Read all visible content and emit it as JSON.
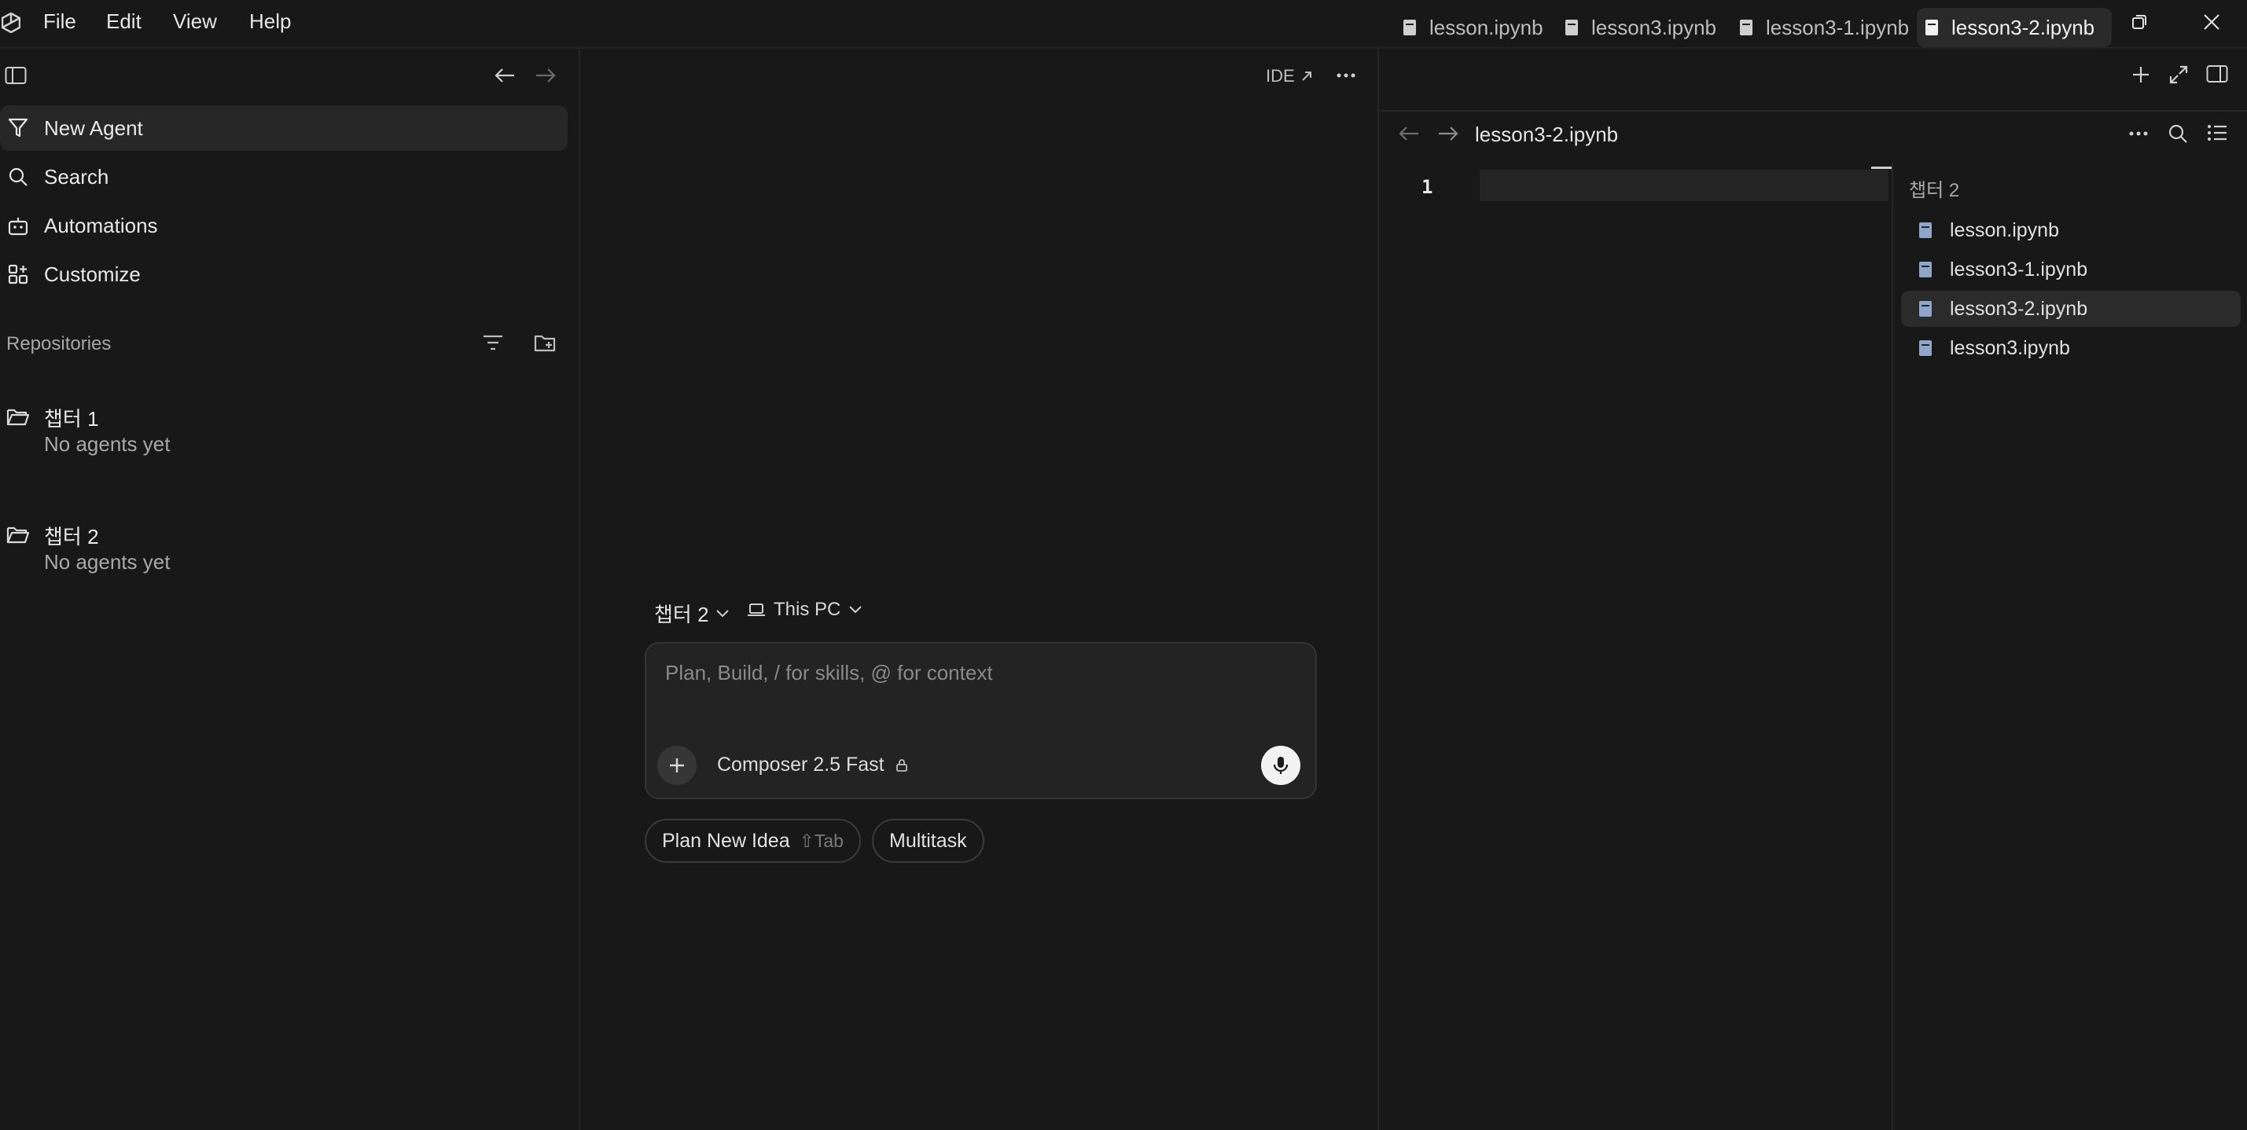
{
  "titlebar": {
    "menu": [
      "File",
      "Edit",
      "View",
      "Help"
    ]
  },
  "sidebar": {
    "items": [
      {
        "label": "New Agent",
        "icon": "agent-icon"
      },
      {
        "label": "Search",
        "icon": "search-icon"
      },
      {
        "label": "Automations",
        "icon": "robot-icon"
      },
      {
        "label": "Customize",
        "icon": "grid-plus-icon"
      }
    ],
    "repositories_label": "Repositories",
    "repos": [
      {
        "name": "챕터 1",
        "empty_text": "No agents yet"
      },
      {
        "name": "챕터 2",
        "empty_text": "No agents yet"
      }
    ]
  },
  "center": {
    "ide_label": "IDE",
    "repo_selector": "챕터 2",
    "env_selector": "This PC",
    "composer_placeholder": "Plan, Build, / for skills, @ for context",
    "model_label": "Composer 2.5 Fast",
    "plan_button": "Plan New Idea",
    "plan_shortcut": "⇧Tab",
    "multitask_button": "Multitask"
  },
  "editor": {
    "tabs": [
      "lesson.ipynb",
      "lesson3.ipynb",
      "lesson3-1.ipynb",
      "lesson3-2.ipynb"
    ],
    "active_tab": "lesson3-2.ipynb",
    "breadcrumb_file": "lesson3-2.ipynb",
    "line_number": "1",
    "outline_title": "챕터 2",
    "outline_files": [
      "lesson.ipynb",
      "lesson3-1.ipynb",
      "lesson3-2.ipynb",
      "lesson3.ipynb"
    ],
    "active_outline_file": "lesson3-2.ipynb"
  },
  "colors": {
    "background": "#181818",
    "active_row": "#272727",
    "file_icon": "#8fa6c9",
    "text": "#e6e6e6"
  }
}
